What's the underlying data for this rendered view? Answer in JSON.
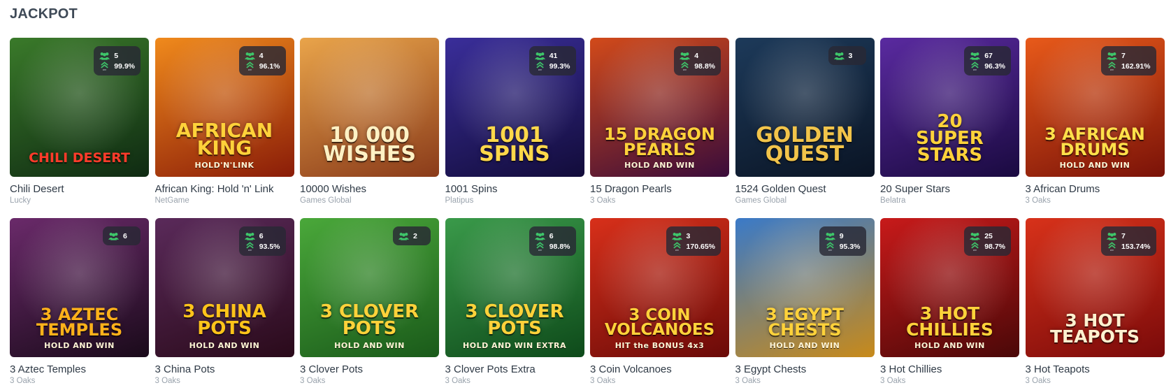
{
  "section": {
    "title": "JACKPOT"
  },
  "icons": {
    "players": "players-icon",
    "rtp": "rtp-chevrons-icon"
  },
  "colors": {
    "stats_bg": "#28283a",
    "players_green": "#3ec56a",
    "title": "#3f4a57",
    "provider": "#9aa3ad"
  },
  "games": [
    {
      "name": "Chili Desert",
      "provider": "Lucky",
      "players": "5",
      "rtp": "99.9%",
      "art": {
        "line1": "Chili Desert",
        "line2": "",
        "sub": "",
        "bg": "#3a7a2a",
        "bg2": "#0f2a12",
        "fg": "#ff3b2a",
        "size": 19
      }
    },
    {
      "name": "African King: Hold 'n' Link",
      "provider": "NetGame",
      "players": "4",
      "rtp": "96.1%",
      "art": {
        "line1": "African",
        "line2": "King",
        "sub": "HOLD'N'LINK",
        "bg": "#f08a1c",
        "bg2": "#8a1c08",
        "fg": "#ffd23a",
        "size": 28
      }
    },
    {
      "name": "10000 Wishes",
      "provider": "Games Global",
      "players": "",
      "rtp": "",
      "art": {
        "line1": "10 000",
        "line2": "Wishes",
        "sub": "",
        "bg": "#e9a44a",
        "bg2": "#8a3b1a",
        "fg": "#fff1c4",
        "size": 30
      }
    },
    {
      "name": "1001 Spins",
      "provider": "Platipus",
      "players": "41",
      "rtp": "99.3%",
      "art": {
        "line1": "1001",
        "line2": "Spins",
        "sub": "",
        "bg": "#3a2e9a",
        "bg2": "#120c3a",
        "fg": "#ffd84a",
        "size": 30
      }
    },
    {
      "name": "15 Dragon Pearls",
      "provider": "3 Oaks",
      "players": "4",
      "rtp": "98.8%",
      "art": {
        "line1": "15 Dragon",
        "line2": "Pearls",
        "sub": "HOLD AND WIN",
        "bg": "#d24a1a",
        "bg2": "#3a0c3a",
        "fg": "#ffd23a",
        "size": 24
      }
    },
    {
      "name": "1524 Golden Quest",
      "provider": "Games Global",
      "players": "3",
      "rtp": "",
      "art": {
        "line1": "Golden",
        "line2": "Quest",
        "sub": "",
        "bg": "#1d3a5a",
        "bg2": "#0a1424",
        "fg": "#f2c44a",
        "size": 30
      }
    },
    {
      "name": "20 Super Stars",
      "provider": "Belatra",
      "players": "67",
      "rtp": "96.3%",
      "art": {
        "line1": "20",
        "line2": "Super Stars",
        "sub": "",
        "bg": "#5a2aa0",
        "bg2": "#1a0a40",
        "fg": "#ffd23a",
        "size": 26
      }
    },
    {
      "name": "3 African Drums",
      "provider": "3 Oaks",
      "players": "7",
      "rtp": "162.91%",
      "art": {
        "line1": "3 African",
        "line2": "Drums",
        "sub": "HOLD AND WIN",
        "bg": "#e85a1a",
        "bg2": "#7a1208",
        "fg": "#ffe04a",
        "size": 24
      }
    },
    {
      "name": "3 Aztec Temples",
      "provider": "3 Oaks",
      "players": "6",
      "rtp": "",
      "art": {
        "line1": "3 Aztec",
        "line2": "Temples",
        "sub": "HOLD AND WIN",
        "bg": "#6a2a6a",
        "bg2": "#1a0a1a",
        "fg": "#ffb21a",
        "size": 24
      }
    },
    {
      "name": "3 China Pots",
      "provider": "3 Oaks",
      "players": "6",
      "rtp": "93.5%",
      "art": {
        "line1": "3 China",
        "line2": "Pots",
        "sub": "HOLD AND WIN",
        "bg": "#5a2a5a",
        "bg2": "#2a0a1a",
        "fg": "#ffc41a",
        "size": 26
      }
    },
    {
      "name": "3 Clover Pots",
      "provider": "3 Oaks",
      "players": "2",
      "rtp": "",
      "art": {
        "line1": "3 Clover",
        "line2": "Pots",
        "sub": "HOLD AND WIN",
        "bg": "#4aa83a",
        "bg2": "#1a5a1a",
        "fg": "#ffd23a",
        "size": 26
      }
    },
    {
      "name": "3 Clover Pots Extra",
      "provider": "3 Oaks",
      "players": "6",
      "rtp": "98.8%",
      "art": {
        "line1": "3 Clover",
        "line2": "Pots",
        "sub": "HOLD AND WIN EXTRA",
        "bg": "#3a9a4a",
        "bg2": "#0e4a1a",
        "fg": "#ffd23a",
        "size": 26
      }
    },
    {
      "name": "3 Coin Volcanoes",
      "provider": "3 Oaks",
      "players": "3",
      "rtp": "170.65%",
      "art": {
        "line1": "3 Coin",
        "line2": "Volcanoes",
        "sub": "HIT the BONUS 4x3",
        "bg": "#d8301a",
        "bg2": "#6a0a08",
        "fg": "#ffd23a",
        "size": 23
      }
    },
    {
      "name": "3 Egypt Chests",
      "provider": "3 Oaks",
      "players": "9",
      "rtp": "95.3%",
      "art": {
        "line1": "3 Egypt",
        "line2": "Chests",
        "sub": "HOLD AND WIN",
        "bg": "#3a7ac8",
        "bg2": "#c88a1a",
        "fg": "#ffd23a",
        "size": 24
      }
    },
    {
      "name": "3 Hot Chillies",
      "provider": "3 Oaks",
      "players": "25",
      "rtp": "98.7%",
      "art": {
        "line1": "3 Hot",
        "line2": "Chillies",
        "sub": "HOLD AND WIN",
        "bg": "#c81a1a",
        "bg2": "#4a0808",
        "fg": "#ffd23a",
        "size": 25
      }
    },
    {
      "name": "3 Hot Teapots",
      "provider": "3 Oaks",
      "players": "7",
      "rtp": "153.74%",
      "art": {
        "line1": "3 Hot",
        "line2": "Teapots",
        "sub": "",
        "bg": "#d8321a",
        "bg2": "#7a0a0a",
        "fg": "#fff1d0",
        "size": 25
      }
    }
  ]
}
